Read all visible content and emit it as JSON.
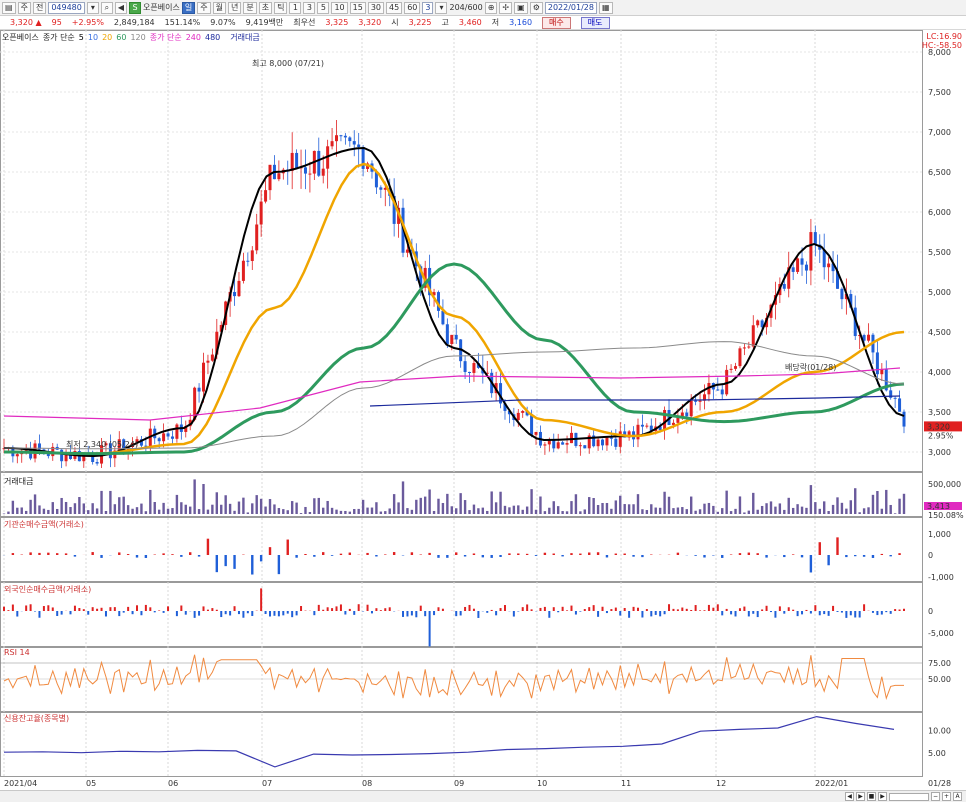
{
  "toolbar": {
    "period_buttons": [
      "일",
      "주",
      "월",
      "년",
      "분",
      "초",
      "틱"
    ],
    "interval_buttons": [
      "1",
      "3",
      "5",
      "10",
      "15",
      "30",
      "45",
      "60"
    ],
    "view_value": "3",
    "counter": "204/600",
    "date": "2022/01/28",
    "stock_name": "오픈베이스",
    "code": "049480",
    "mode": "주",
    "mode2": "전"
  },
  "quote": {
    "price": "3,320",
    "change": "95",
    "rate": "+2.95%",
    "volume": "2,849,184",
    "vol_ratio": "151.14%",
    "turnover": "9.07%",
    "amount": "9,419백만",
    "best_label": "최우선",
    "ask": "3,325",
    "bid": "3,320",
    "open_label": "시",
    "open": "3,225",
    "high_label": "고",
    "high": "3,460",
    "low_label": "저",
    "low": "3,160",
    "buy_label": "매수",
    "sell_label": "매도"
  },
  "legend_main": {
    "name": "오픈베이스",
    "ma_label": "종가 단순",
    "ma_periods": [
      "5",
      "10",
      "20",
      "60",
      "120"
    ],
    "ma_colors": [
      "#000000",
      "#3a6fe0",
      "#f0a500",
      "#2e9a5e",
      "#8a8a8a"
    ],
    "ma2_label": "종가 단순",
    "ma2_periods": [
      "240",
      "480"
    ],
    "ma2_colors": [
      "#e02ac0",
      "#1c2a9c"
    ],
    "vol_label": "거래대금"
  },
  "corner": {
    "lc": "LC:16.90",
    "hc": "HC:-58.50"
  },
  "annotations": {
    "high": "최고 8,000 (07/21)",
    "low": "최저 2,340 (05/24)",
    "dividend": "배당락(01/28)"
  },
  "price_axis": [
    "8,000",
    "7,500",
    "7,000",
    "6,500",
    "6,000",
    "5,500",
    "5,000",
    "4,500",
    "4,000",
    "3,500",
    "3,000"
  ],
  "current_price": {
    "value": "3,320",
    "rate": "2.95%"
  },
  "panels": {
    "volume": {
      "title": "거래대금",
      "axis": "500,000",
      "value": "3,413",
      "ratio": "150.08%"
    },
    "inst": {
      "title": "기관순매수금액(거래소)",
      "axis": [
        "1,000",
        "0",
        "-1,000"
      ]
    },
    "foreign": {
      "title": "외국인순매수금액(거래소)",
      "axis": [
        "0",
        "-5,000"
      ]
    },
    "rsi": {
      "title": "RSI 14",
      "axis": [
        "75.00",
        "50.00"
      ]
    },
    "credit": {
      "title": "신용잔고율(종목별)",
      "axis": [
        "10.00",
        "5.00"
      ]
    }
  },
  "date_axis": [
    "2021/04",
    "05",
    "06",
    "07",
    "08",
    "09",
    "10",
    "11",
    "12",
    "2022/01",
    "01/28"
  ],
  "colors": {
    "up": "#e02020",
    "down": "#1f5fd8",
    "vol": "#6a5a9c",
    "rsi": "#f08a40",
    "credit": "#3a3ab0"
  },
  "chart_data": {
    "type": "line",
    "title": "오픈베이스",
    "x": [
      "2021/04",
      "05",
      "06",
      "07",
      "08",
      "09",
      "10",
      "11",
      "12",
      "2022/01",
      "01/28"
    ],
    "series": [
      {
        "name": "5",
        "values": [
          3050,
          2950,
          3300,
          6500,
          6800,
          4300,
          3150,
          3200,
          3850,
          5600,
          3450
        ]
      },
      {
        "name": "20",
        "values": [
          3000,
          2980,
          3100,
          4800,
          6600,
          4700,
          3400,
          3200,
          3500,
          4000,
          4500
        ]
      },
      {
        "name": "60",
        "values": [
          3000,
          2980,
          3000,
          3500,
          4300,
          5350,
          4400,
          3500,
          3380,
          3500,
          3850
        ]
      },
      {
        "name": "120",
        "values": [
          3050,
          3040,
          3050,
          3200,
          3800,
          4200,
          4250,
          4300,
          4380,
          4200,
          3850
        ]
      }
    ],
    "ylim": [
      2800,
      8200
    ],
    "xlabel": "",
    "ylabel": ""
  }
}
